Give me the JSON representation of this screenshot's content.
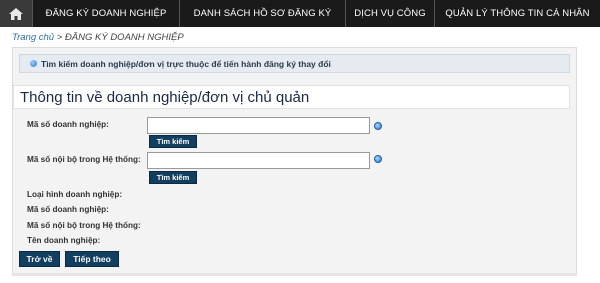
{
  "nav": {
    "home_icon": "home-icon",
    "items": [
      {
        "label": "ĐĂNG KÝ DOANH NGHIỆP"
      },
      {
        "label": "DANH SÁCH HỒ SƠ ĐĂNG KÝ"
      },
      {
        "label": "DỊCH VỤ CÔNG"
      },
      {
        "label": "QUẢN LÝ THÔNG TIN CÁ NHÂN"
      }
    ]
  },
  "breadcrumb": {
    "home": "Trang chủ",
    "separator": ">",
    "current": "ĐĂNG KÝ DOANH NGHIỆP"
  },
  "info_bar": {
    "text": "Tìm kiếm doanh nghiệp/đơn vị trực thuộc để tiến hành đăng ký thay đổi"
  },
  "section": {
    "title": "Thông tin về doanh nghiệp/đơn vị chủ quản"
  },
  "form": {
    "enterprise_code_label": "Mã số doanh nghiệp:",
    "enterprise_code_value": "",
    "internal_code_label": "Mã số nội bộ trong Hệ thống:",
    "internal_code_value": "",
    "search_button_label": "Tìm kiếm"
  },
  "details": {
    "type_label": "Loại hình doanh nghiệp:",
    "enterprise_code_label": "Mã số doanh nghiệp:",
    "internal_code_label": "Mã số nội bộ trong Hệ thống:",
    "name_label": "Tên doanh nghiệp:"
  },
  "actions": {
    "back_label": "Trở về",
    "next_label": "Tiếp theo"
  },
  "colors": {
    "nav_bg": "#1a1a1a",
    "button_bg": "#123e60",
    "info_bar_bg": "#e6ebf1",
    "link": "#2f6da4"
  }
}
